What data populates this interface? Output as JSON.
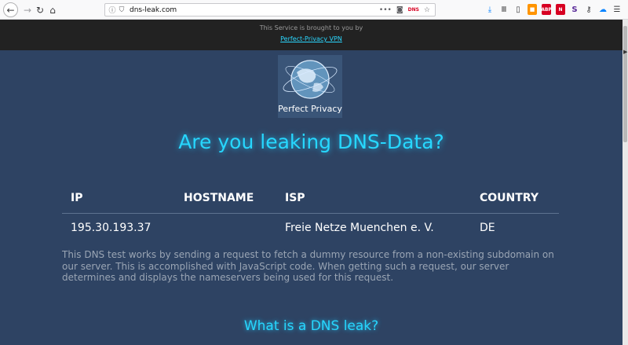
{
  "browser": {
    "url": "dns-leak.com",
    "url_action_more": "•••",
    "dns_badge": "DNS"
  },
  "banner": {
    "text": "This Service is brought to you by",
    "link": "Perfect-Privacy VPN"
  },
  "logo": {
    "text": "Perfect Privacy"
  },
  "headline": "Are you leaking DNS-Data?",
  "table": {
    "headers": [
      "IP",
      "HOSTNAME",
      "ISP",
      "COUNTRY"
    ],
    "rows": [
      [
        "195.30.193.37",
        "",
        "Freie Netze Muenchen e. V.",
        "DE"
      ]
    ]
  },
  "description": "This DNS test works by sending a request to fetch a dummy resource from a non-existing subdomain on our server. This is accomplished with JavaScript code. When getting such a request, our server determines and displays the nameservers being used for this request.",
  "subheading": "What is a DNS leak?",
  "colors": {
    "accent": "#27d7ff",
    "page_bg": "#2e4363",
    "banner_bg": "#222222"
  }
}
